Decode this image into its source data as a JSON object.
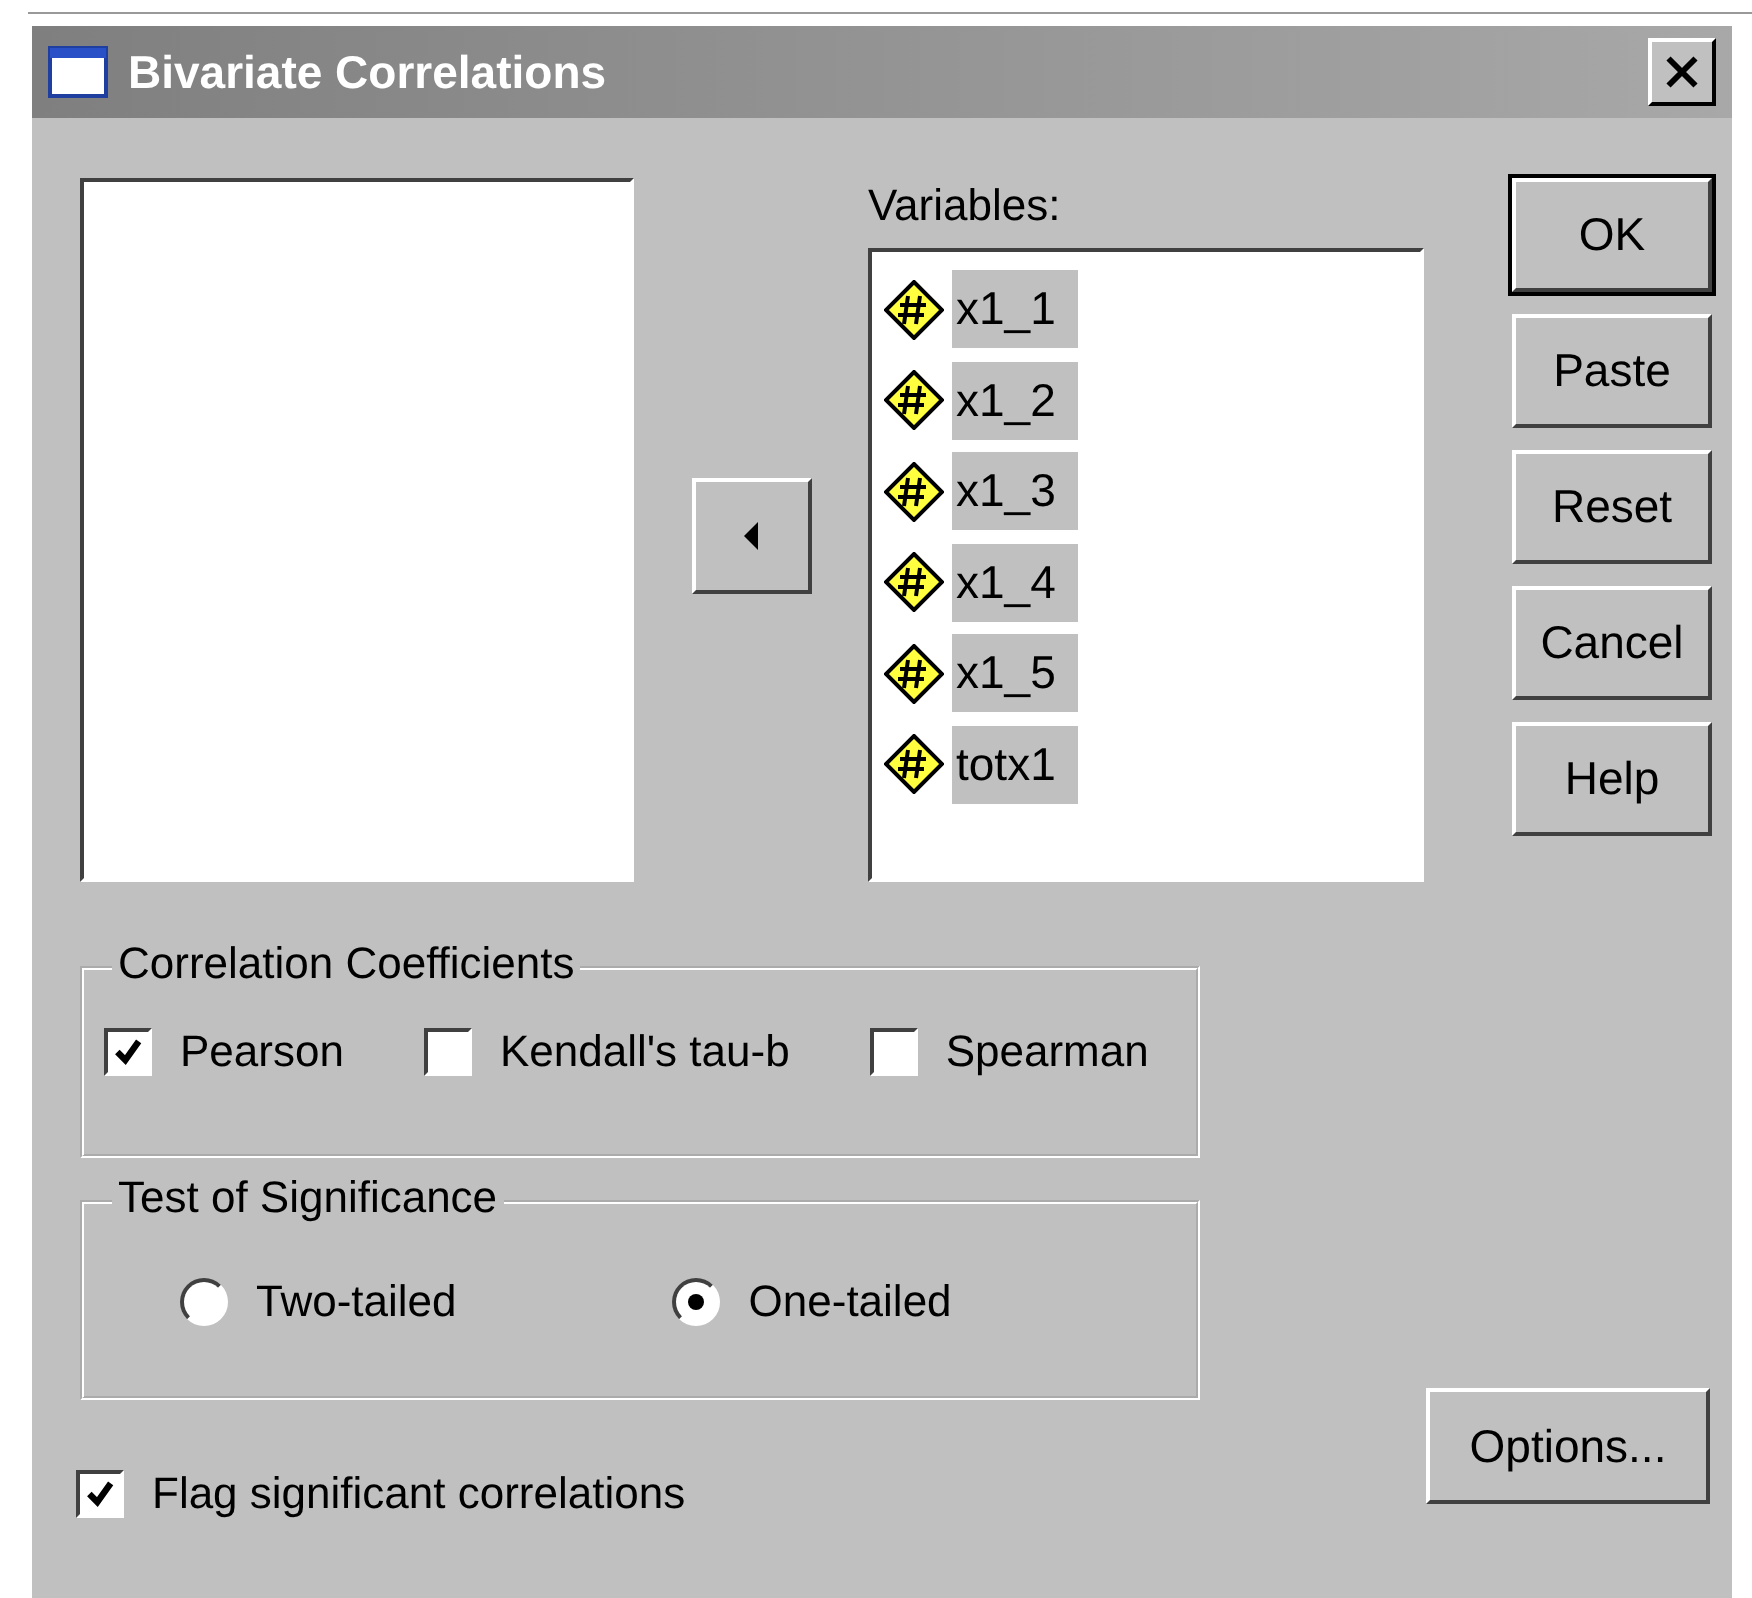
{
  "window": {
    "title": "Bivariate Correlations"
  },
  "variables": {
    "label": "Variables:",
    "items": [
      {
        "name": "x1_1",
        "selected": true
      },
      {
        "name": "x1_2",
        "selected": true
      },
      {
        "name": "x1_3",
        "selected": true
      },
      {
        "name": "x1_4",
        "selected": true
      },
      {
        "name": "x1_5",
        "selected": true
      },
      {
        "name": "totx1",
        "selected": true
      }
    ]
  },
  "buttons": [
    {
      "label": "OK",
      "default": true
    },
    {
      "label": "Paste",
      "default": false
    },
    {
      "label": "Reset",
      "default": false
    },
    {
      "label": "Cancel",
      "default": false
    },
    {
      "label": "Help",
      "default": false
    }
  ],
  "correlation_coefficients": {
    "title": "Correlation Coefficients",
    "options": [
      {
        "label": "Pearson",
        "checked": true
      },
      {
        "label": "Kendall's tau-b",
        "checked": false
      },
      {
        "label": "Spearman",
        "checked": false
      }
    ]
  },
  "test_of_significance": {
    "title": "Test of Significance",
    "options": [
      {
        "label": "Two-tailed",
        "selected": false
      },
      {
        "label": "One-tailed",
        "selected": true
      }
    ]
  },
  "flag_significant": {
    "label": "Flag significant correlations",
    "checked": true
  },
  "options_button": {
    "label": "Options..."
  }
}
